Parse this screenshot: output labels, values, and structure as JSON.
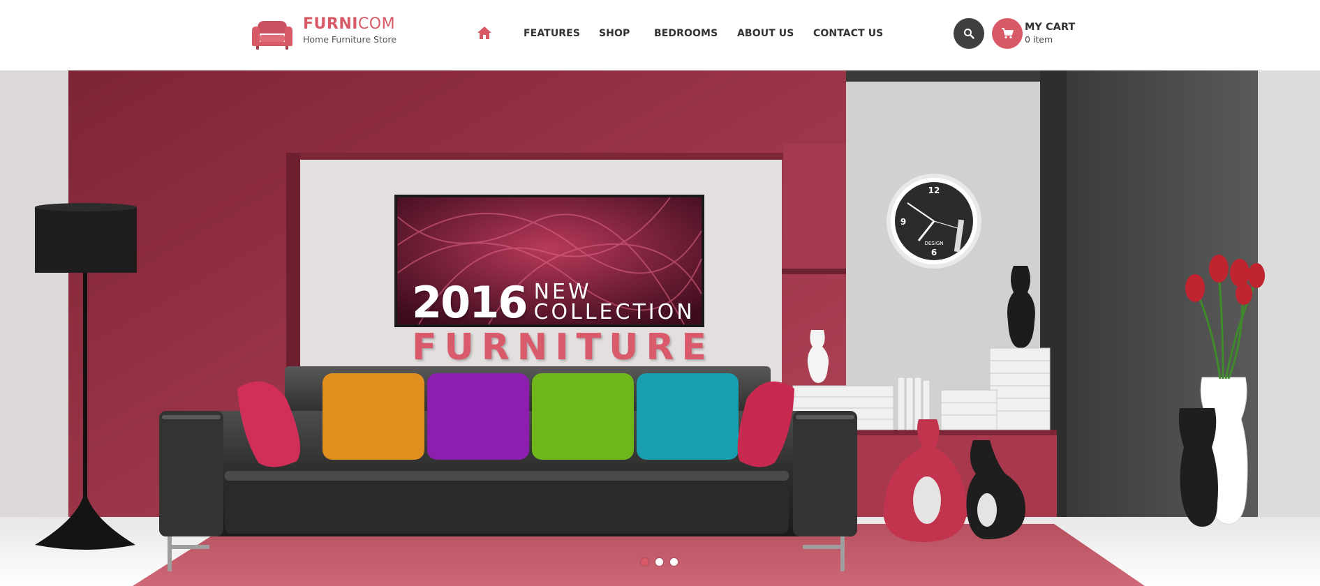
{
  "brand": {
    "name_bold": "FURNI",
    "name_light": "COM",
    "tagline": "Home Furniture Store",
    "accent_color": "#d95a67",
    "icon": "sofa-logo-icon"
  },
  "nav": {
    "home_icon": "home-icon",
    "items": [
      {
        "label": "FEATURES"
      },
      {
        "label": "SHOP"
      },
      {
        "label": "BEDROOMS"
      },
      {
        "label": "ABOUT US"
      },
      {
        "label": "CONTACT US"
      }
    ]
  },
  "header_actions": {
    "search_icon": "search-icon",
    "cart_icon": "cart-icon",
    "cart_title": "MY CART",
    "cart_count": "0 item"
  },
  "hero": {
    "year": "2016",
    "line1": "NEW",
    "line2": "COLLECTION",
    "headline": "FURNITURE",
    "clock_top": "12",
    "clock_left": "9",
    "clock_bottom": "6",
    "clock_brand": "DESIGN",
    "slides_total": 3,
    "active_slide": 1
  }
}
